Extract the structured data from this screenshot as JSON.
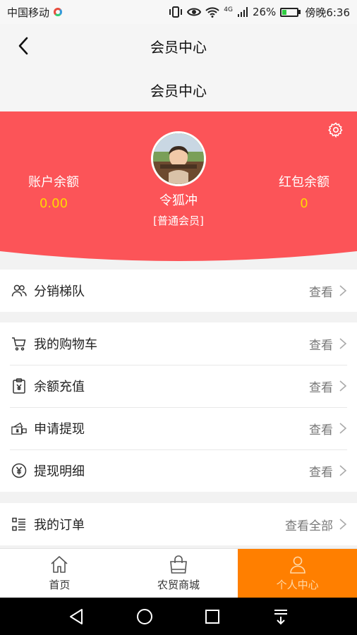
{
  "status_bar": {
    "carrier": "中国移动",
    "signal_label": "4G",
    "battery_percent": "26%",
    "time": "傍晚6:36",
    "battery_level": 0.26
  },
  "nav": {
    "back_icon": "chevron-left-icon",
    "title": "会员中心"
  },
  "sub_title": "会员中心",
  "profile": {
    "background_color": "#fc5458",
    "account_balance_label": "账户余额",
    "account_balance_value": "0.00",
    "username": "令狐冲",
    "member_level": "[普通会员]",
    "red_packet_label": "红包余额",
    "red_packet_value": "0",
    "value_color": "#ffd800"
  },
  "sections": {
    "distribution": {
      "label": "分销梯队",
      "action": "查看",
      "icon": "users-icon"
    },
    "wallet": [
      {
        "label": "我的购物车",
        "action": "查看",
        "icon": "cart-icon"
      },
      {
        "label": "余额充值",
        "action": "查看",
        "icon": "recharge-icon"
      },
      {
        "label": "申请提现",
        "action": "查看",
        "icon": "withdraw-icon"
      },
      {
        "label": "提现明细",
        "action": "查看",
        "icon": "yen-icon"
      }
    ],
    "orders": {
      "label": "我的订单",
      "action": "查看全部",
      "icon": "list-icon"
    }
  },
  "tabs": [
    {
      "label": "首页",
      "icon": "home-icon",
      "active": false
    },
    {
      "label": "农贸商城",
      "icon": "bag-icon",
      "active": false
    },
    {
      "label": "个人中心",
      "icon": "person-icon",
      "active": true
    }
  ],
  "colors": {
    "accent": "#ff7f00",
    "profile_bg": "#fc5458"
  }
}
